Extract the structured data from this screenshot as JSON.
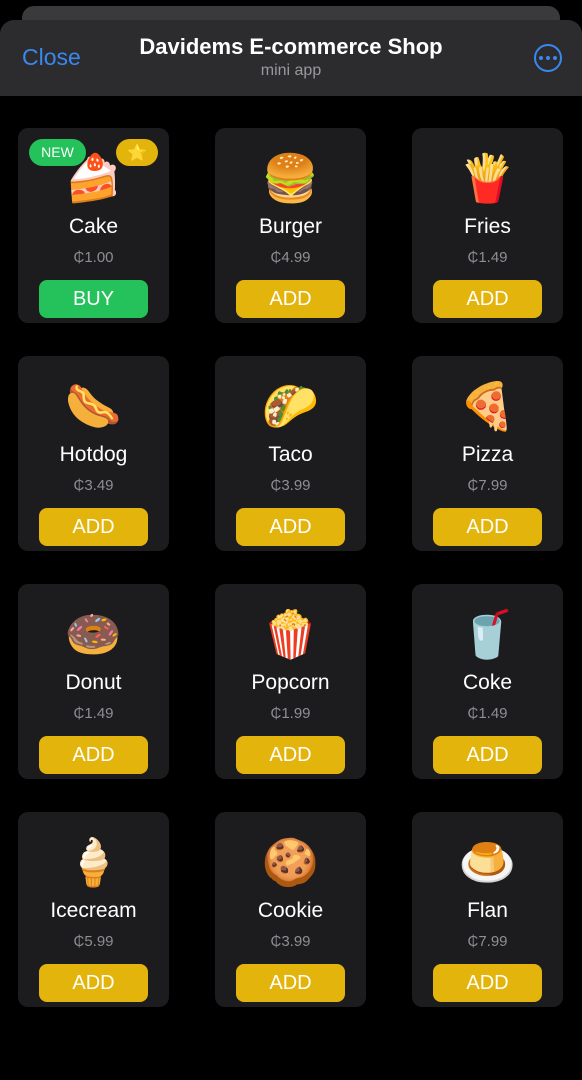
{
  "header": {
    "close_label": "Close",
    "title": "Davidems E-commerce Shop",
    "subtitle": "mini app",
    "more_icon": "more-icon"
  },
  "colors": {
    "accent_blue": "#3a87f0",
    "add_yellow": "#e3b40c",
    "buy_green": "#25c15b",
    "card_bg": "#1c1c1e",
    "header_bg": "#2c2c2e"
  },
  "badges": {
    "new_label": "NEW",
    "star_label": "⭐"
  },
  "items": [
    {
      "name": "Cake",
      "price": "₵1.00",
      "emoji": "🍰",
      "button": "BUY"
    },
    {
      "name": "Burger",
      "price": "₵4.99",
      "emoji": "🍔",
      "button": "ADD"
    },
    {
      "name": "Fries",
      "price": "₵1.49",
      "emoji": "🍟",
      "button": "ADD"
    },
    {
      "name": "Hotdog",
      "price": "₵3.49",
      "emoji": "🌭",
      "button": "ADD"
    },
    {
      "name": "Taco",
      "price": "₵3.99",
      "emoji": "🌮",
      "button": "ADD"
    },
    {
      "name": "Pizza",
      "price": "₵7.99",
      "emoji": "🍕",
      "button": "ADD"
    },
    {
      "name": "Donut",
      "price": "₵1.49",
      "emoji": "🍩",
      "button": "ADD"
    },
    {
      "name": "Popcorn",
      "price": "₵1.99",
      "emoji": "🍿",
      "button": "ADD"
    },
    {
      "name": "Coke",
      "price": "₵1.49",
      "emoji": "🥤",
      "button": "ADD"
    },
    {
      "name": "Icecream",
      "price": "₵5.99",
      "emoji": "🍦",
      "button": "ADD"
    },
    {
      "name": "Cookie",
      "price": "₵3.99",
      "emoji": "🍪",
      "button": "ADD"
    },
    {
      "name": "Flan",
      "price": "₵7.99",
      "emoji": "🍮",
      "button": "ADD"
    }
  ]
}
